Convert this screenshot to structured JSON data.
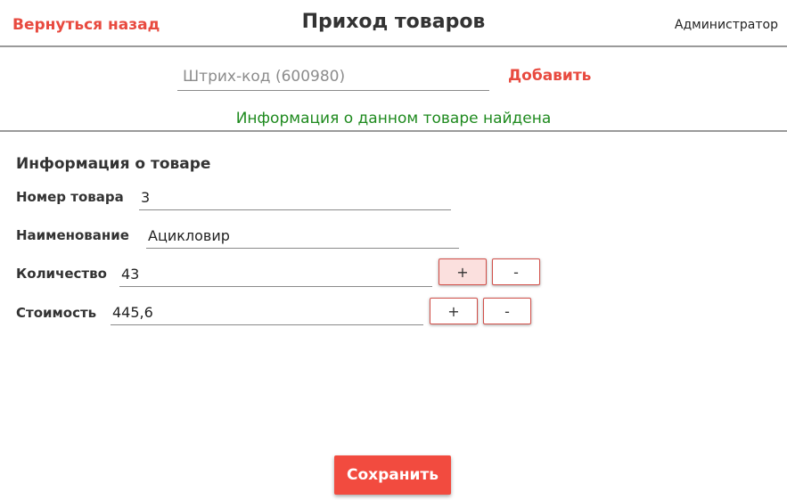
{
  "header": {
    "back_label": "Вернуться назад",
    "title": "Приход товаров",
    "user": "Администратор"
  },
  "search": {
    "placeholder": "Штрих-код (600980)",
    "value": "",
    "add_label": "Добавить"
  },
  "status": {
    "message": "Информация о данном товаре найдена",
    "color": "#1e8a1e"
  },
  "product": {
    "section_title": "Информация о товаре",
    "number_label": "Номер товара",
    "number_value": "3",
    "name_label": "Наименование",
    "name_value": "Ацикловир",
    "quantity_label": "Количество",
    "quantity_value": "43",
    "price_label": "Стоимость",
    "price_value": "445,6",
    "increment_label": "+",
    "decrement_label": "-"
  },
  "footer": {
    "save_label": "Сохранить"
  },
  "colors": {
    "accent": "#e84a3f",
    "button": "#f24b3f",
    "success": "#1e8a1e"
  }
}
